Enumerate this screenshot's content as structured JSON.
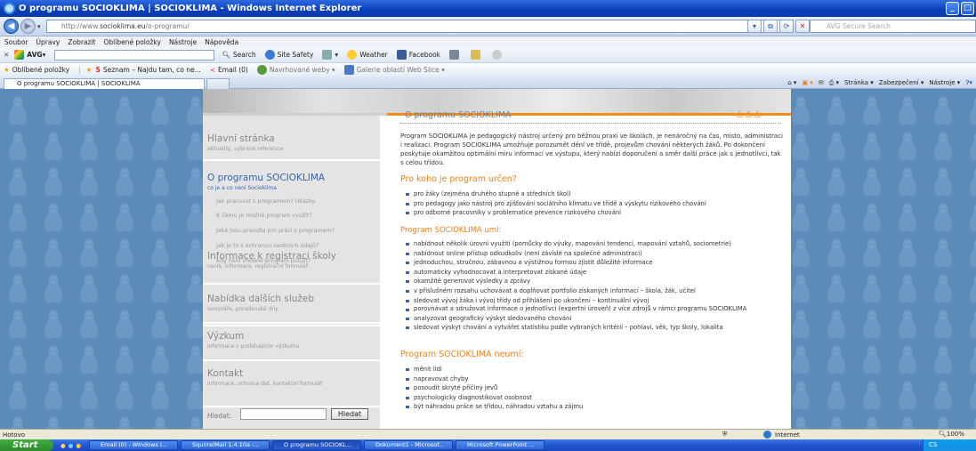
{
  "window": {
    "title": "O programu SOCIOKLIMA | SOCIOKLIMA - Windows Internet Explorer"
  },
  "address": {
    "url_prefix": "http://www.",
    "url_domain": "socioklima.eu",
    "url_path": "/o-programu/",
    "search_placeholder": "AVG Secure Search"
  },
  "menu": [
    "Soubor",
    "Úpravy",
    "Zobrazit",
    "Oblíbené položky",
    "Nástroje",
    "Nápověda"
  ],
  "avg_toolbar": {
    "brand": "AVG",
    "items": [
      "Search",
      "Site Safety",
      "Weather",
      "Facebook"
    ]
  },
  "favorites": {
    "label": "Oblíbené položky",
    "items": [
      "Seznam – Najdu tam, co ne...",
      "Email (0)",
      "Navrhované weby ▾",
      "Galerie oblastí Web Slice ▾"
    ]
  },
  "tab": {
    "label": "O programu SOCIOKLIMA | SOCIOKLIMA"
  },
  "command_bar": [
    "Stránka ▾",
    "Zabezpečení ▾",
    "Nástroje ▾"
  ],
  "nav": {
    "sections": [
      {
        "title": "Hlavní stránka",
        "sub": "aktuality, vybrané reference"
      },
      {
        "title": "O programu SOCIOKLIMA",
        "sub": "co je a co není Socioklima"
      },
      {
        "title": "Informace k registraci školy",
        "sub": "ceník, informace, registrační formulář"
      },
      {
        "title": "Nabídka dalších služeb",
        "sub": "semináře, poradenské dny"
      },
      {
        "title": "Výzkum",
        "sub": "informace o probíhajícím výzkumu"
      },
      {
        "title": "Kontakt",
        "sub": "informace, ochrana dat, kontaktní formulář"
      }
    ],
    "subitems": [
      "Jak pracovat s programem? Ukázky.",
      "K čemu je možné program využít?",
      "Jaká jsou pravidla pro práci s programem?",
      "Jak je to s ochranou osobních údajů?",
      "Kdy není vhodné program použít?"
    ],
    "search_label": "Hledat:",
    "search_button": "Hledat"
  },
  "main": {
    "title": "O programu SOCIOKLIMA",
    "intro": "Program SOCIOKLIMA je pedagogický nástroj určený pro běžnou praxi ve školách, je nenáročný na čas, místo, administraci i realizaci. Program SOCIOKLIMA umožňuje porozumět dění ve třídě, projevům chování některých žáků. Po dokončení poskytuje okamžitou optimální míru informací ve výstupu, který nabízí doporučení a směr další práce jak s jednotlivci, tak s celou třídou.",
    "h_for": "Pro koho je program určen?",
    "for_items": [
      "pro žáky (zejména druhého stupně a středních škol)",
      "pro pedagogy jako nástroj pro zjišťování sociálního klimatu ve třídě a výskytu rizikového chování",
      "pro odborné pracovníky v problematice prevence rizikového chování"
    ],
    "h_can": "Program SOCIOKLIMA umí:",
    "can_items": [
      "nabídnout několik úrovní využití (pomůcky do výuky, mapování tendencí, mapování vztahů, sociometrie)",
      "nabídnout online přístup odkudkoliv (není závislé na společné administraci)",
      "jednoduchou, stručnou, zábavnou a výstižnou formou zjistit důležité informace",
      "automaticky vyhodnocovat a interpretovat získané údaje",
      "okamžitě generovat výsledky a zprávy",
      "v příslušném rozsahu uchovávat a doplňovat portfolio získaných informací – škola, žák, učitel",
      "sledovat vývoj žáka i vývoj třídy od přihlášení po ukončení – kontinuální vývoj",
      "porovnávat a sdružovat informace o jednotlivci (expertní úroveň) z více zdrojů v rámci programu SOCIOKLIMA",
      "analyzovat geografický výskyt sledovaného chování",
      "sledovat výskyt chování a vytvářet statistiku podle vybraných kritérií – pohlaví, věk, typ školy, lokalita"
    ],
    "h_cannot": "Program SOCIOKLIMA neumí:",
    "cannot_items": [
      "měnit lidi",
      "napravovat chyby",
      "posoudit skryté příčiny jevů",
      "psychologicky diagnostikovat osobnost",
      "být náhradou práce se třídou, náhradou vztahu a zájmu"
    ]
  },
  "status": {
    "left": "Hotovo",
    "zone": "Internet",
    "zoom": "100%"
  },
  "taskbar": {
    "start": "Start",
    "tasks": [
      "Email (0) - Windows I...",
      "SquirrelMail 1.4.10a -...",
      "O programu SOCIOKL...",
      "Dokument1 - Microsof...",
      "Microsoft PowerPoint ..."
    ],
    "tray": "CS"
  }
}
